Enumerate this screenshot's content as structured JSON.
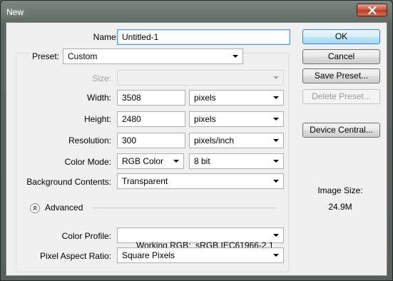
{
  "window": {
    "title": "New"
  },
  "form": {
    "name_label": "Name:",
    "name_value": "Untitled-1",
    "preset_label": "Preset:",
    "preset_value": "Custom",
    "size_label": "Size:",
    "size_value": "",
    "width_label": "Width:",
    "width_value": "3508",
    "width_unit": "pixels",
    "height_label": "Height:",
    "height_value": "2480",
    "height_unit": "pixels",
    "resolution_label": "Resolution:",
    "resolution_value": "300",
    "resolution_unit": "pixels/inch",
    "color_mode_label": "Color Mode:",
    "color_mode_value": "RGB Color",
    "bit_depth_value": "8 bit",
    "background_label": "Background Contents:",
    "background_value": "Transparent",
    "advanced_label": "Advanced",
    "color_profile_label": "Color Profile:",
    "color_profile_value": "Working RGB:  sRGB IEC61966-2.1",
    "pixel_aspect_label": "Pixel Aspect Ratio:",
    "pixel_aspect_value": "Square Pixels"
  },
  "buttons": {
    "ok": "OK",
    "cancel": "Cancel",
    "save_preset": "Save Preset...",
    "delete_preset": "Delete Preset...",
    "device_central": "Device Central..."
  },
  "info": {
    "image_size_label": "Image Size:",
    "image_size_value": "24.9M"
  },
  "icons": {
    "close": "close-icon",
    "advanced_toggle": "chevron-up-icon",
    "dropdown": "dropdown-arrow-icon"
  }
}
